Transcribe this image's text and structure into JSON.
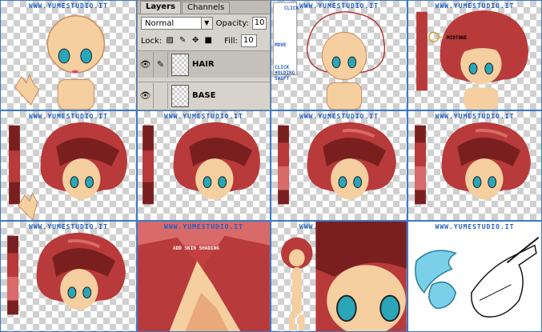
{
  "watermark": "WWW.YUMESTUDIO.IT",
  "panel": {
    "tabs": [
      "Layers",
      "Channels"
    ],
    "blend_mode": "Normal",
    "opacity_label": "Opacity:",
    "opacity_value": "10",
    "lock_label": "Lock:",
    "fill_label": "Fill:",
    "fill_value": "10",
    "layers": [
      {
        "name": "HAIR",
        "selected": true
      },
      {
        "name": "BASE",
        "selected": false
      }
    ]
  },
  "annotations": {
    "click": "CLICK",
    "move": "MOVE",
    "click_holding_shift": [
      "CLICK",
      "HOLDING",
      "SHIFT"
    ],
    "midtone": "MIDTONE",
    "add_skin_shading": "ADD SKIN SHADING"
  },
  "colors": {
    "checker_light": "#ffffff",
    "checker_dark": "#d0d0d0",
    "tile_border": "#3b78c8",
    "watermark": "#1f5fc4",
    "skin": "#f6cfa0",
    "skin_shadow": "#e9a97a",
    "hair": "#b83a3a",
    "hair_dark": "#7a1f1f",
    "hair_light": "#d86a6a",
    "eye": "#2aa6b8"
  }
}
